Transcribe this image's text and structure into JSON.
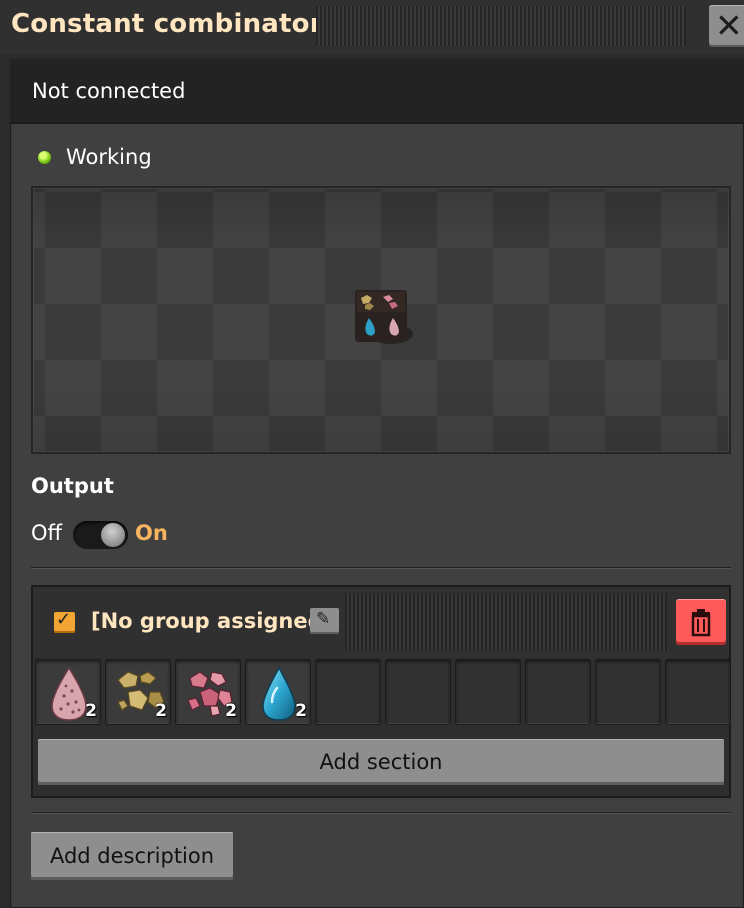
{
  "window": {
    "title": "Constant combinator",
    "close_icon": "close-icon"
  },
  "status": {
    "connection": "Not connected",
    "state": "Working",
    "state_color": "#7fcc19"
  },
  "output": {
    "label": "Output",
    "off_label": "Off",
    "on_label": "On",
    "value": "On"
  },
  "section": {
    "enabled": true,
    "group_label": "[No group assigned]",
    "edit_icon": "pencil-icon",
    "delete_icon": "trash-icon",
    "signals": [
      {
        "icon": "fish-egg-drop-icon",
        "count": "2"
      },
      {
        "icon": "iron-ore-chunks-icon",
        "count": "2"
      },
      {
        "icon": "copper-ore-chunks-icon",
        "count": "2"
      },
      {
        "icon": "water-drop-icon",
        "count": "2"
      }
    ],
    "empty_slots": 6,
    "add_section_label": "Add section"
  },
  "footer": {
    "add_description_label": "Add description"
  },
  "colors": {
    "title_text": "#ffe6c0",
    "accent_orange": "#f7b55f",
    "delete_red": "#fe5a5a"
  }
}
